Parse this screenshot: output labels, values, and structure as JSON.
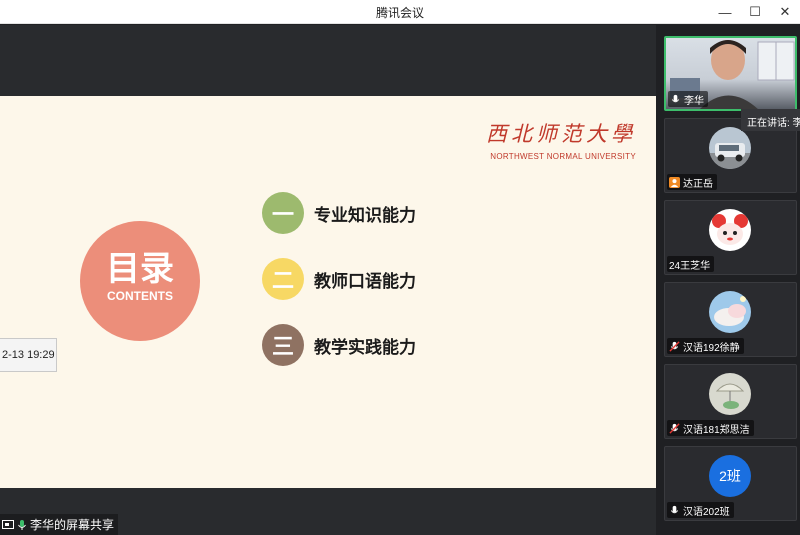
{
  "window": {
    "title": "腾讯会议",
    "minimize_glyph": "—",
    "maximize_glyph": "☐",
    "close_glyph": "✕"
  },
  "slide": {
    "university_cn": "西北师范大學",
    "university_en": "NORTHWEST NORMAL UNIVERSITY",
    "toc_title": "目录",
    "toc_subtitle": "CONTENTS",
    "items": [
      {
        "num": "一",
        "label": "专业知识能力",
        "color": "#9dba6e"
      },
      {
        "num": "二",
        "label": "教师口语能力",
        "color": "#f7d864"
      },
      {
        "num": "三",
        "label": "教学实践能力",
        "color": "#8f7262"
      }
    ],
    "accent_color": "#ec8e7a"
  },
  "timestamp": "2-13 19:29",
  "screen_share_label": "李华的屏幕共享",
  "speaking_tooltip": "正在讲话: 李",
  "participants": [
    {
      "name": "李华",
      "icon": "mic-icon",
      "active": true
    },
    {
      "name": "达正岳",
      "icon": "user-icon"
    },
    {
      "name": "24王芝华",
      "icon": "none"
    },
    {
      "name": "汉语192徐静",
      "icon": "mic-muted-icon"
    },
    {
      "name": "汉语181郑思洁",
      "icon": "mic-muted-icon"
    },
    {
      "name": "汉语202班",
      "icon": "mic-icon",
      "avatar_text": "2班"
    }
  ]
}
